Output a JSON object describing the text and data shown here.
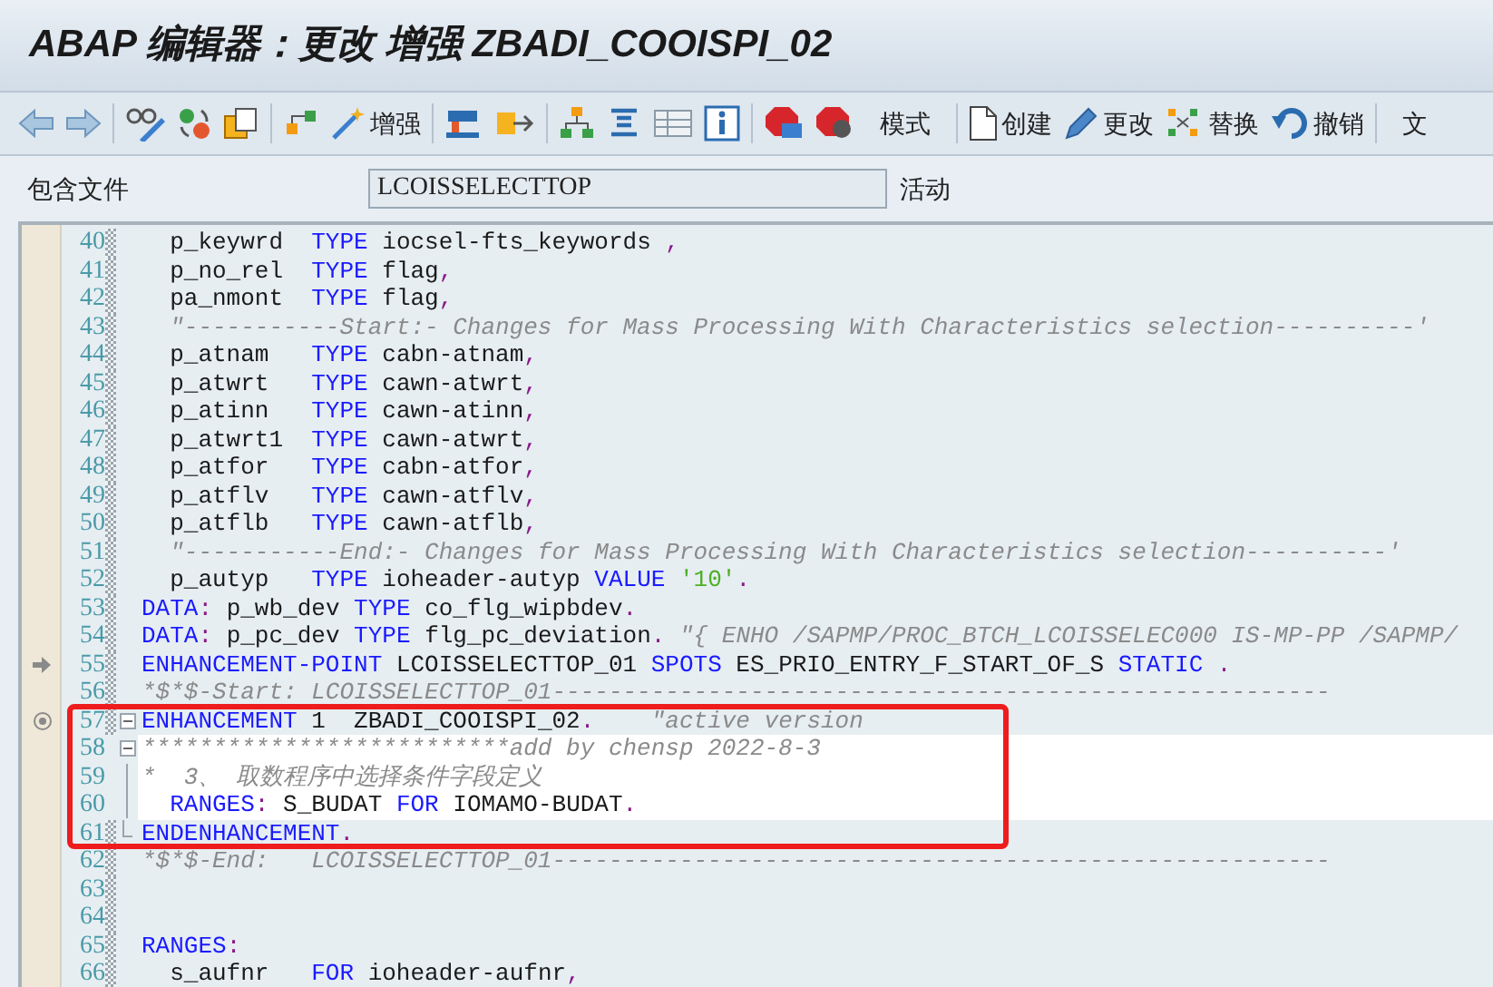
{
  "window": {
    "title": "ABAP 编辑器：更改 增强 ZBADI_COOISPI_02"
  },
  "toolbar": [
    "增强",
    "模式",
    "创建",
    "更改",
    "替换",
    "撤销",
    "文"
  ],
  "include_field": {
    "label": "包含文件",
    "value": "LCOISSELECTTOP",
    "status": "活动"
  },
  "highlight_box": true,
  "lines": [
    {
      "number": "40",
      "highlighted": false,
      "segments": [
        {
          "kind": "text",
          "text": "  p_keywrd  "
        },
        {
          "kind": "keyword",
          "text": "TYPE"
        },
        {
          "kind": "text",
          "text": " iocsel-fts_keywords "
        },
        {
          "kind": "punct",
          "text": ","
        }
      ]
    },
    {
      "number": "41",
      "highlighted": false,
      "segments": [
        {
          "kind": "text",
          "text": "  p_no_rel  "
        },
        {
          "kind": "keyword",
          "text": "TYPE"
        },
        {
          "kind": "text",
          "text": " flag"
        },
        {
          "kind": "punct",
          "text": ","
        }
      ]
    },
    {
      "number": "42",
      "highlighted": false,
      "segments": [
        {
          "kind": "text",
          "text": "  pa_nmont  "
        },
        {
          "kind": "keyword",
          "text": "TYPE"
        },
        {
          "kind": "text",
          "text": " flag"
        },
        {
          "kind": "punct",
          "text": ","
        }
      ]
    },
    {
      "number": "43",
      "highlighted": false,
      "segments": [
        {
          "kind": "comment",
          "text": "  \"-----------Start:- Changes for Mass Processing With Characteristics selection----------'"
        }
      ]
    },
    {
      "number": "44",
      "highlighted": false,
      "segments": [
        {
          "kind": "text",
          "text": "  p_atnam   "
        },
        {
          "kind": "keyword",
          "text": "TYPE"
        },
        {
          "kind": "text",
          "text": " cabn-atnam"
        },
        {
          "kind": "punct",
          "text": ","
        }
      ]
    },
    {
      "number": "45",
      "highlighted": false,
      "segments": [
        {
          "kind": "text",
          "text": "  p_atwrt   "
        },
        {
          "kind": "keyword",
          "text": "TYPE"
        },
        {
          "kind": "text",
          "text": " cawn-atwrt"
        },
        {
          "kind": "punct",
          "text": ","
        }
      ]
    },
    {
      "number": "46",
      "highlighted": false,
      "segments": [
        {
          "kind": "text",
          "text": "  p_atinn   "
        },
        {
          "kind": "keyword",
          "text": "TYPE"
        },
        {
          "kind": "text",
          "text": " cawn-atinn"
        },
        {
          "kind": "punct",
          "text": ","
        }
      ]
    },
    {
      "number": "47",
      "highlighted": false,
      "segments": [
        {
          "kind": "text",
          "text": "  p_atwrt1  "
        },
        {
          "kind": "keyword",
          "text": "TYPE"
        },
        {
          "kind": "text",
          "text": " cawn-atwrt"
        },
        {
          "kind": "punct",
          "text": ","
        }
      ]
    },
    {
      "number": "48",
      "highlighted": false,
      "segments": [
        {
          "kind": "text",
          "text": "  p_atfor   "
        },
        {
          "kind": "keyword",
          "text": "TYPE"
        },
        {
          "kind": "text",
          "text": " cabn-atfor"
        },
        {
          "kind": "punct",
          "text": ","
        }
      ]
    },
    {
      "number": "49",
      "highlighted": false,
      "segments": [
        {
          "kind": "text",
          "text": "  p_atflv   "
        },
        {
          "kind": "keyword",
          "text": "TYPE"
        },
        {
          "kind": "text",
          "text": " cawn-atflv"
        },
        {
          "kind": "punct",
          "text": ","
        }
      ]
    },
    {
      "number": "50",
      "highlighted": false,
      "segments": [
        {
          "kind": "text",
          "text": "  p_atflb   "
        },
        {
          "kind": "keyword",
          "text": "TYPE"
        },
        {
          "kind": "text",
          "text": " cawn-atflb"
        },
        {
          "kind": "punct",
          "text": ","
        }
      ]
    },
    {
      "number": "51",
      "highlighted": false,
      "segments": [
        {
          "kind": "comment",
          "text": "  \"-----------End:- Changes for Mass Processing With Characteristics selection----------'"
        }
      ]
    },
    {
      "number": "52",
      "highlighted": false,
      "segments": [
        {
          "kind": "text",
          "text": "  p_autyp   "
        },
        {
          "kind": "keyword",
          "text": "TYPE"
        },
        {
          "kind": "text",
          "text": " ioheader-autyp "
        },
        {
          "kind": "keyword",
          "text": "VALUE "
        },
        {
          "kind": "string",
          "text": "'10'"
        },
        {
          "kind": "punct",
          "text": "."
        }
      ]
    },
    {
      "number": "53",
      "highlighted": false,
      "segments": [
        {
          "kind": "keyword",
          "text": "DATA"
        },
        {
          "kind": "punct",
          "text": ":"
        },
        {
          "kind": "text",
          "text": " p_wb_dev "
        },
        {
          "kind": "keyword",
          "text": "TYPE"
        },
        {
          "kind": "text",
          "text": " co_flg_wipbdev"
        },
        {
          "kind": "punct",
          "text": "."
        }
      ]
    },
    {
      "number": "54",
      "highlighted": false,
      "segments": [
        {
          "kind": "keyword",
          "text": "DATA"
        },
        {
          "kind": "punct",
          "text": ":"
        },
        {
          "kind": "text",
          "text": " p_pc_dev "
        },
        {
          "kind": "keyword",
          "text": "TYPE"
        },
        {
          "kind": "text",
          "text": " flg_pc_deviation"
        },
        {
          "kind": "punct",
          "text": "."
        },
        {
          "kind": "comment",
          "text": " \"{ ENHO /SAPMP/PROC_BTCH_LCOISSELEC000 IS-MP-PP /SAPMP/"
        }
      ]
    },
    {
      "number": "55",
      "highlighted": false,
      "enhancement_point": true,
      "segments": [
        {
          "kind": "keyword",
          "text": "ENHANCEMENT-POINT"
        },
        {
          "kind": "text",
          "text": " LCOISSELECTTOP_01 "
        },
        {
          "kind": "keyword",
          "text": "SPOTS"
        },
        {
          "kind": "text",
          "text": " ES_PRIO_ENTRY_F_START_OF_S "
        },
        {
          "kind": "keyword",
          "text": "STATIC "
        },
        {
          "kind": "punct",
          "text": "."
        }
      ]
    },
    {
      "number": "56",
      "highlighted": false,
      "segments": [
        {
          "kind": "comment",
          "text": "*$*$-Start: LCOISSELECTTOP_01-------------------------------------------------------"
        }
      ]
    },
    {
      "number": "57",
      "highlighted": false,
      "implementation": true,
      "collapsible": true,
      "segments": [
        {
          "kind": "keyword",
          "text": "ENHANCEMENT"
        },
        {
          "kind": "text",
          "text": " 1  ZBADI_COOISPI_02"
        },
        {
          "kind": "punct",
          "text": "."
        },
        {
          "kind": "comment",
          "text": "    \"active version"
        }
      ]
    },
    {
      "number": "58",
      "highlighted": true,
      "collapsible": true,
      "segments": [
        {
          "kind": "comment",
          "text": "**************************add by chensp 2022-8-3"
        }
      ]
    },
    {
      "number": "59",
      "highlighted": true,
      "in_block": true,
      "segments": [
        {
          "kind": "comment",
          "text": "*  3、 取数程序中选择条件字段定义"
        }
      ]
    },
    {
      "number": "60",
      "highlighted": true,
      "in_block": true,
      "segments": [
        {
          "kind": "keyword",
          "text": "  RANGES"
        },
        {
          "kind": "punct",
          "text": ":"
        },
        {
          "kind": "text",
          "text": " S_BUDAT "
        },
        {
          "kind": "keyword",
          "text": "FOR"
        },
        {
          "kind": "text",
          "text": " IOMAMO-BUDAT"
        },
        {
          "kind": "punct",
          "text": "."
        }
      ]
    },
    {
      "number": "61",
      "highlighted": false,
      "block_end": true,
      "segments": [
        {
          "kind": "keyword",
          "text": "ENDENHANCEMENT"
        },
        {
          "kind": "punct",
          "text": "."
        }
      ]
    },
    {
      "number": "62",
      "highlighted": false,
      "segments": [
        {
          "kind": "comment",
          "text": "*$*$-End:   LCOISSELECTTOP_01-------------------------------------------------------"
        }
      ]
    },
    {
      "number": "63",
      "highlighted": false
    },
    {
      "number": "64",
      "highlighted": false
    },
    {
      "number": "65",
      "highlighted": false,
      "segments": [
        {
          "kind": "keyword",
          "text": "RANGES"
        },
        {
          "kind": "punct",
          "text": ":"
        }
      ]
    },
    {
      "number": "66",
      "highlighted": false,
      "segments": [
        {
          "kind": "text",
          "text": "  s_aufnr   "
        },
        {
          "kind": "keyword",
          "text": "FOR"
        },
        {
          "kind": "text",
          "text": " ioheader-aufnr"
        },
        {
          "kind": "punct",
          "text": ","
        }
      ]
    }
  ]
}
